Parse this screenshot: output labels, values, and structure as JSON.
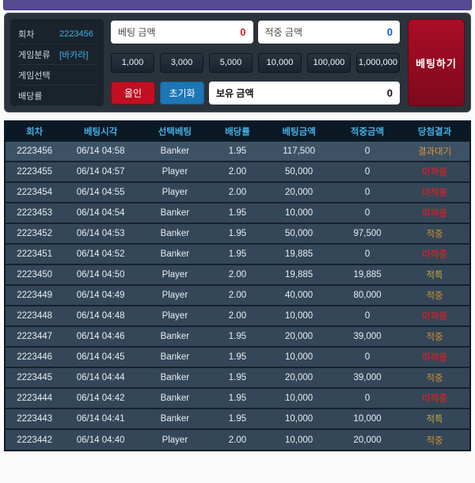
{
  "bet_panel": {
    "info": [
      {
        "label": "회차",
        "value": "2223456"
      },
      {
        "label": "게임분류",
        "value": "[바카라]"
      },
      {
        "label": "게임선택",
        "value": ""
      },
      {
        "label": "배당률",
        "value": ""
      }
    ],
    "bet_amount": {
      "label": "베팅 금액",
      "value": "0"
    },
    "win_amount": {
      "label": "적중 금액",
      "value": "0"
    },
    "quick_amounts": [
      "1,000",
      "3,000",
      "5,000",
      "10,000",
      "100,000",
      "1,000,000"
    ],
    "allin_label": "올인",
    "reset_label": "초기화",
    "balance": {
      "label": "보유 금액",
      "value": "0"
    },
    "bet_button_label": "베팅하기"
  },
  "history_table": {
    "columns": [
      "회차",
      "베팅시각",
      "선택베팅",
      "배당률",
      "베팅금액",
      "적중금액",
      "당첨결과"
    ],
    "rows": [
      {
        "round": "2223456",
        "time": "06/14 04:58",
        "pick": "Banker",
        "odds": "1.95",
        "bet": "117,500",
        "win": "0",
        "result": "결과대기"
      },
      {
        "round": "2223455",
        "time": "06/14 04:57",
        "pick": "Player",
        "odds": "2.00",
        "bet": "50,000",
        "win": "0",
        "result": "미적중"
      },
      {
        "round": "2223454",
        "time": "06/14 04:55",
        "pick": "Player",
        "odds": "2.00",
        "bet": "20,000",
        "win": "0",
        "result": "미적중"
      },
      {
        "round": "2223453",
        "time": "06/14 04:54",
        "pick": "Banker",
        "odds": "1.95",
        "bet": "10,000",
        "win": "0",
        "result": "미적중"
      },
      {
        "round": "2223452",
        "time": "06/14 04:53",
        "pick": "Banker",
        "odds": "1.95",
        "bet": "50,000",
        "win": "97,500",
        "result": "적중"
      },
      {
        "round": "2223451",
        "time": "06/14 04:52",
        "pick": "Banker",
        "odds": "1.95",
        "bet": "19,885",
        "win": "0",
        "result": "미적중"
      },
      {
        "round": "2223450",
        "time": "06/14 04:50",
        "pick": "Player",
        "odds": "2.00",
        "bet": "19,885",
        "win": "19,885",
        "result": "적특"
      },
      {
        "round": "2223449",
        "time": "06/14 04:49",
        "pick": "Player",
        "odds": "2.00",
        "bet": "40,000",
        "win": "80,000",
        "result": "적중"
      },
      {
        "round": "2223448",
        "time": "06/14 04:48",
        "pick": "Player",
        "odds": "2.00",
        "bet": "10,000",
        "win": "0",
        "result": "미적중"
      },
      {
        "round": "2223447",
        "time": "06/14 04:46",
        "pick": "Banker",
        "odds": "1.95",
        "bet": "20,000",
        "win": "39,000",
        "result": "적중"
      },
      {
        "round": "2223446",
        "time": "06/14 04:45",
        "pick": "Banker",
        "odds": "1.95",
        "bet": "10,000",
        "win": "0",
        "result": "미적중"
      },
      {
        "round": "2223445",
        "time": "06/14 04:44",
        "pick": "Banker",
        "odds": "1.95",
        "bet": "20,000",
        "win": "39,000",
        "result": "적중"
      },
      {
        "round": "2223444",
        "time": "06/14 04:42",
        "pick": "Banker",
        "odds": "1.95",
        "bet": "10,000",
        "win": "0",
        "result": "미적중"
      },
      {
        "round": "2223443",
        "time": "06/14 04:41",
        "pick": "Banker",
        "odds": "1.95",
        "bet": "10,000",
        "win": "10,000",
        "result": "적특"
      },
      {
        "round": "2223442",
        "time": "06/14 04:40",
        "pick": "Player",
        "odds": "2.00",
        "bet": "10,000",
        "win": "20,000",
        "result": "적중"
      }
    ],
    "result_colors": {
      "결과대기": "#e0913c",
      "미적중": "#c2252a",
      "적중": "#d8902e",
      "적특": "#c9a93a"
    }
  },
  "theme": {
    "header_purple": "#564a92",
    "panel_bg": "#2a333c",
    "table_header_text": "#43b0e2",
    "row_bg": "#344758",
    "current_row_bg": "#3d5265",
    "allin_red": "#c20f22",
    "reset_blue": "#1d76b5",
    "bet_button_red": "#ac0d27"
  }
}
